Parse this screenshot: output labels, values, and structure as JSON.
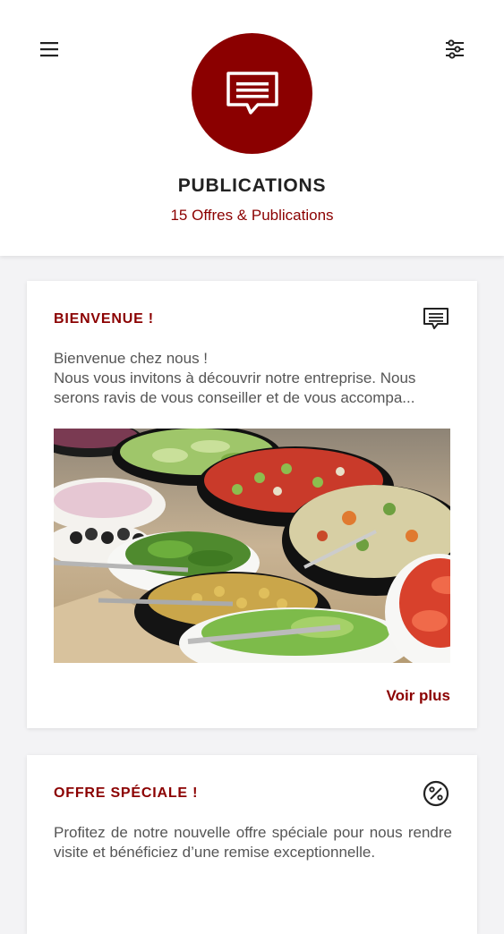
{
  "header": {
    "title": "PUBLICATIONS",
    "subtitle": "15 Offres & Publications",
    "menu_icon": "hamburger-menu-icon",
    "filter_icon": "sliders-filter-icon",
    "logo_icon": "chat-message-icon"
  },
  "colors": {
    "accent": "#8b0000",
    "background": "#f3f3f5",
    "card": "#ffffff",
    "text": "#555555",
    "title": "#222222"
  },
  "cards": [
    {
      "title": "BIENVENUE !",
      "icon": "chat-message-icon",
      "lines": [
        "Bienvenue chez nous !",
        "Nous vous invitons à découvrir notre entreprise. Nous",
        "serons ravis de vous conseiller et de vous accompa..."
      ],
      "image": "salad-buffet-photo",
      "link": "Voir plus"
    },
    {
      "title": "OFFRE SPÉCIALE !",
      "icon": "percent-discount-icon",
      "text": "Profitez de notre nouvelle offre spéciale pour nous rendre visite et bénéficiez d’une remise exceptionnelle."
    }
  ]
}
